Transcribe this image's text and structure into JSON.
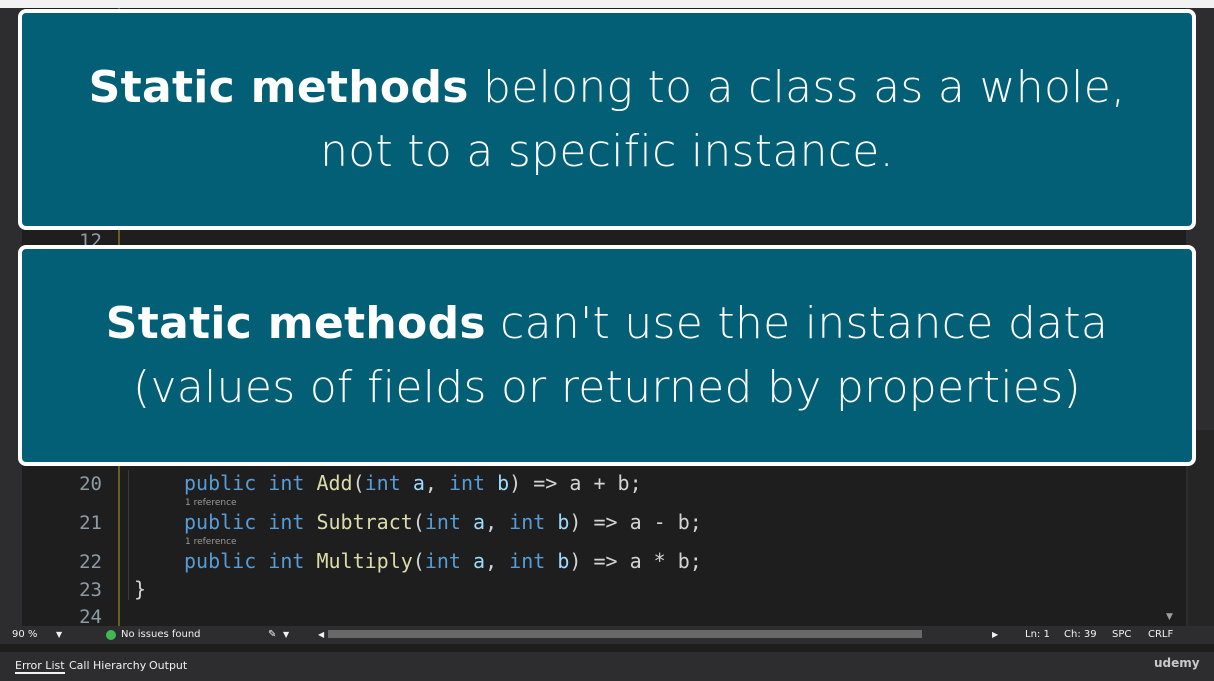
{
  "overlays": {
    "top": {
      "bold": "Static methods",
      "rest": " belong to a class as a whole, not to a specific instance."
    },
    "bottom": {
      "bold": "Static methods",
      "rest": " can't use the instance data (values of fields or returned by properties)"
    }
  },
  "editor": {
    "visible_line_numbers": {
      "l12": "12",
      "l20": "20",
      "l21": "21",
      "l22": "22",
      "l23": "23",
      "l24": "24"
    },
    "codelens": "1 reference",
    "lines": {
      "add": {
        "kw1": "public",
        "kw2": "int",
        "fn": "Add",
        "p1": "(",
        "k3": "int",
        "a": "a",
        "c": ", ",
        "k4": "int",
        "b": "b",
        "rest": ") => a + b;"
      },
      "sub": {
        "kw1": "public",
        "kw2": "int",
        "fn": "Subtract",
        "p1": "(",
        "k3": "int",
        "a": "a",
        "c": ", ",
        "k4": "int",
        "b": "b",
        "rest": ") => a - b;"
      },
      "mul": {
        "kw1": "public",
        "kw2": "int",
        "fn": "Multiply",
        "p1": "(",
        "k3": "int",
        "a": "a",
        "c": ", ",
        "k4": "int",
        "b": "b",
        "rest": ") => a * b;"
      },
      "close": "}"
    }
  },
  "statusbar": {
    "zoom": "90 %",
    "issues": "No issues found",
    "ln": "Ln: 1",
    "ch": "Ch: 39",
    "spc": "SPC",
    "crlf": "CRLF"
  },
  "bottom_tabs": [
    "Error List",
    "Call Hierarchy",
    "Output"
  ],
  "watermark": "udemy",
  "colors": {
    "overlay_bg": "#035f75",
    "overlay_border": "#ffffff",
    "keyword": "#569cd6",
    "function": "#dcdcaa"
  }
}
